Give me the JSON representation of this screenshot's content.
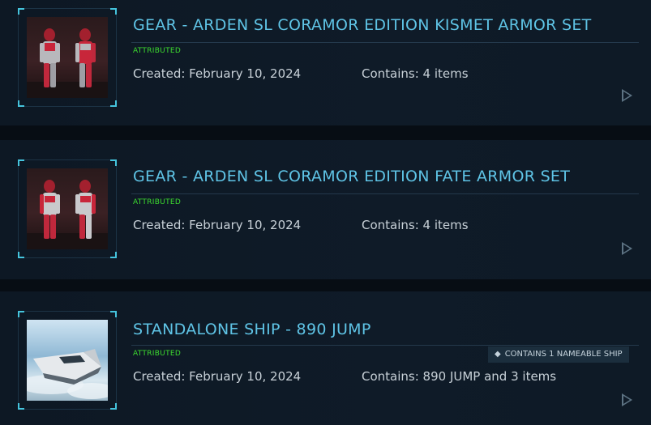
{
  "items": [
    {
      "title": "GEAR - ARDEN SL CORAMOR EDITION KISMET ARMOR SET",
      "status": "ATTRIBUTED",
      "created": "Created: February 10, 2024",
      "contains": "Contains: 4 items",
      "thumbnail_icon": "armor-set-image"
    },
    {
      "title": "GEAR - ARDEN SL CORAMOR EDITION FATE ARMOR SET",
      "status": "ATTRIBUTED",
      "created": "Created: February 10, 2024",
      "contains": "Contains: 4 items",
      "thumbnail_icon": "armor-set-image"
    },
    {
      "title": "STANDALONE SHIP - 890 JUMP",
      "status": "ATTRIBUTED",
      "created": "Created: February 10, 2024",
      "contains": "Contains: 890 JUMP and 3 items",
      "badge": "CONTAINS 1 NAMEABLE SHIP",
      "thumbnail_icon": "ship-image"
    }
  ],
  "colors": {
    "title": "#5fc4e6",
    "attributed": "#3ddc2f",
    "corner_accent": "#45c4dd",
    "background": "#070d14"
  }
}
